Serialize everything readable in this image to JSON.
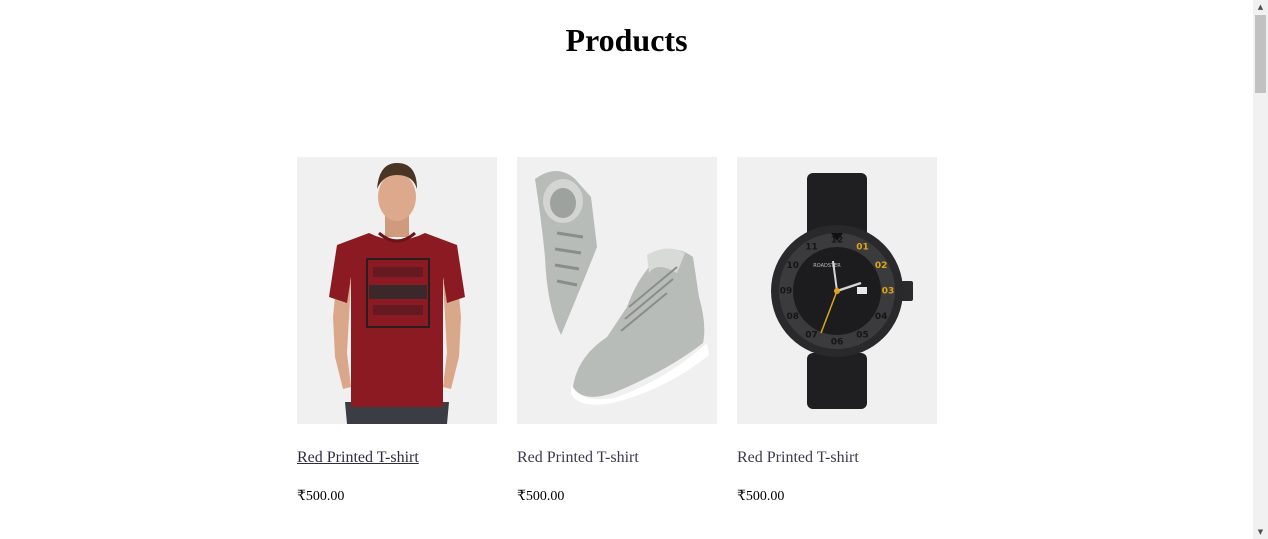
{
  "page": {
    "title": "Products"
  },
  "products": [
    {
      "name": "Red Printed T-shirt",
      "price": "₹500.00",
      "image_icon": "tshirt-model-image"
    },
    {
      "name": "Red Printed T-shirt",
      "price": "₹500.00",
      "image_icon": "sneakers-image"
    },
    {
      "name": "Red Printed T-shirt",
      "price": "₹500.00",
      "image_icon": "wristwatch-image"
    }
  ],
  "watch": {
    "brand": "ROADSTER",
    "numerals": [
      "01",
      "02",
      "03",
      "04",
      "05",
      "06",
      "07",
      "08",
      "09",
      "10",
      "11",
      "12"
    ]
  },
  "colors": {
    "tile_background": "#f0f0f0",
    "tshirt": "#8b1a22",
    "sneaker": "#b8bcb9",
    "watch_accent": "#e0a516"
  }
}
